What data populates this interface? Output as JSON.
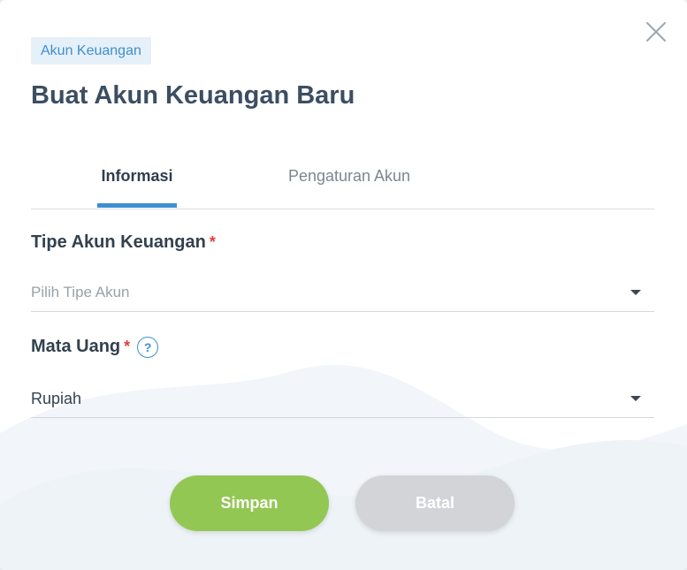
{
  "dialog": {
    "badge": "Akun Keuangan",
    "title": "Buat Akun Keuangan Baru"
  },
  "tabs": [
    {
      "label": "Informasi",
      "active": true
    },
    {
      "label": "Pengaturan Akun",
      "active": false
    }
  ],
  "fields": {
    "account_type": {
      "label": "Tipe Akun Keuangan",
      "required_mark": "*",
      "placeholder": "Pilih Tipe Akun",
      "value": ""
    },
    "currency": {
      "label": "Mata Uang",
      "required_mark": "*",
      "help": "?",
      "value": "Rupiah"
    }
  },
  "actions": {
    "save_label": "Simpan",
    "cancel_label": "Batal"
  },
  "icons": {
    "close": "close-icon",
    "help": "question-circle-icon",
    "dropdown": "caret-down-icon"
  },
  "colors": {
    "accent": "#3d8fd1",
    "save": "#93c753",
    "cancel": "#d2d4d7",
    "required": "#e04040",
    "title": "#3c4e61"
  }
}
